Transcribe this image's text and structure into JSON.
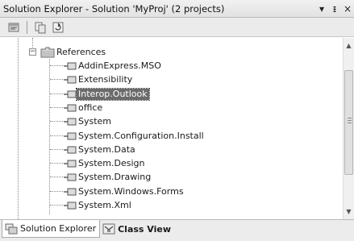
{
  "window": {
    "title": "Solution Explorer - Solution 'MyProj' (2 projects)",
    "pin_glyph": "▾",
    "autohide_glyph": "ᵻ",
    "close_glyph": "×"
  },
  "toolbar": {
    "buttons": [
      {
        "icon": "properties-icon"
      },
      {
        "icon": "show-all-files-icon"
      },
      {
        "icon": "refresh-icon"
      }
    ]
  },
  "tree": {
    "root": {
      "label": "References",
      "icon": "references-folder-icon",
      "expanded": true
    },
    "items": [
      {
        "label": "AddinExpress.MSO",
        "icon": "assembly-reference-icon",
        "selected": false
      },
      {
        "label": "Extensibility",
        "icon": "assembly-reference-icon",
        "selected": false
      },
      {
        "label": "Interop.Outlook",
        "icon": "assembly-reference-icon",
        "selected": true
      },
      {
        "label": "office",
        "icon": "assembly-reference-icon",
        "selected": false
      },
      {
        "label": "System",
        "icon": "assembly-reference-icon",
        "selected": false
      },
      {
        "label": "System.Configuration.Install",
        "icon": "assembly-reference-icon",
        "selected": false
      },
      {
        "label": "System.Data",
        "icon": "assembly-reference-icon",
        "selected": false
      },
      {
        "label": "System.Design",
        "icon": "assembly-reference-icon",
        "selected": false
      },
      {
        "label": "System.Drawing",
        "icon": "assembly-reference-icon",
        "selected": false
      },
      {
        "label": "System.Windows.Forms",
        "icon": "assembly-reference-icon",
        "selected": false
      },
      {
        "label": "System.Xml",
        "icon": "assembly-reference-icon",
        "selected": false
      }
    ]
  },
  "bottom_tabs": [
    {
      "label": "Solution Explorer",
      "icon": "solution-explorer-icon",
      "active": true
    },
    {
      "label": "Class View",
      "icon": "class-view-icon",
      "active": false
    }
  ]
}
